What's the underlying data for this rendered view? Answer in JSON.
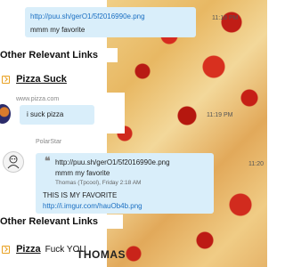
{
  "messages": [
    {
      "text_link": "http://puu.sh/gerO1/5f2016990e.png",
      "text": "mmm my favorite",
      "time": "11:18 PM"
    },
    {
      "source": "www.pizza.com",
      "text": "i suck pizza",
      "time": "11:19 PM"
    },
    {
      "author": "PolarStar",
      "quote_link": "http://puu.sh/gerO1/5f2016990e.png",
      "quote_text": "mmm my favorite",
      "quote_meta": "Thomas (Tpcool), Friday 2:18 AM",
      "text": "THIS IS MY FAVORITE",
      "link": "http://i.imgur.com/hauOb4b.png",
      "time": "11:20"
    }
  ],
  "sections": [
    {
      "heading": "Other Relevant Links",
      "link_label": "Pizza Suck"
    },
    {
      "heading": "Other Relevant Links",
      "link_label_1": "Pizza",
      "link_label_2": "Fuck YOU",
      "overlay": "THOMAS"
    }
  ],
  "colors": {
    "bubble": "#d9eefa",
    "link": "#1a6fc2",
    "arrow": "#e8a020"
  }
}
